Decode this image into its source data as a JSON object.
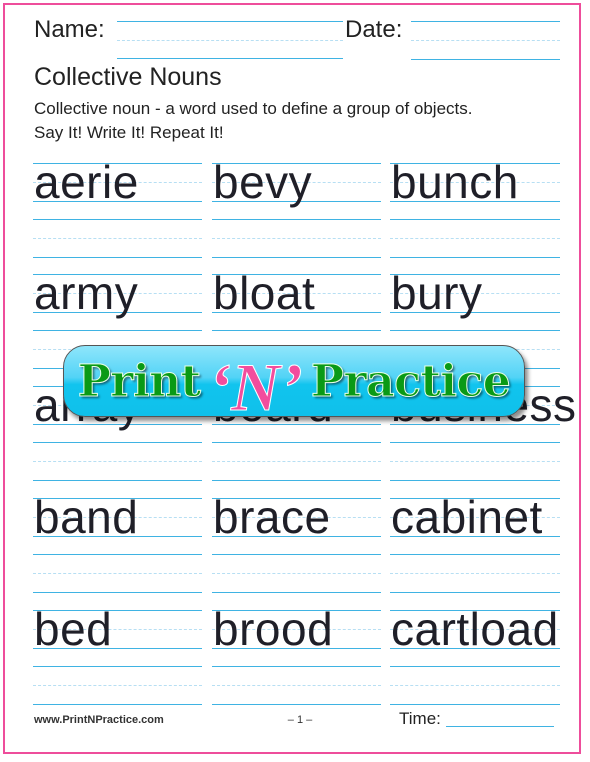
{
  "header": {
    "name_label": "Name:",
    "date_label": "Date:"
  },
  "title": "Collective Nouns",
  "description": "Collective noun - a word used to define a group of objects.",
  "instruction": "Say It! Write It! Repeat It!",
  "words": [
    [
      "aerie",
      "bevy",
      "bunch"
    ],
    [
      "army",
      "bloat",
      "bury"
    ],
    [
      "array",
      "board",
      "business"
    ],
    [
      "band",
      "brace",
      "cabinet"
    ],
    [
      "bed",
      "brood",
      "cartload"
    ]
  ],
  "logo": {
    "part1": "Print",
    "part2": "‘N’",
    "part3": "Practice",
    "colors": {
      "green": "#0a9a16",
      "pink": "#f24d9d",
      "cyan": "#11c4ee"
    }
  },
  "footer": {
    "website": "www.PrintNPractice.com",
    "page": "– 1 –",
    "time_label": "Time:"
  },
  "colors": {
    "border": "#ee4d9b",
    "line": "#3fb3e3",
    "dashed": "#b7dff3"
  }
}
